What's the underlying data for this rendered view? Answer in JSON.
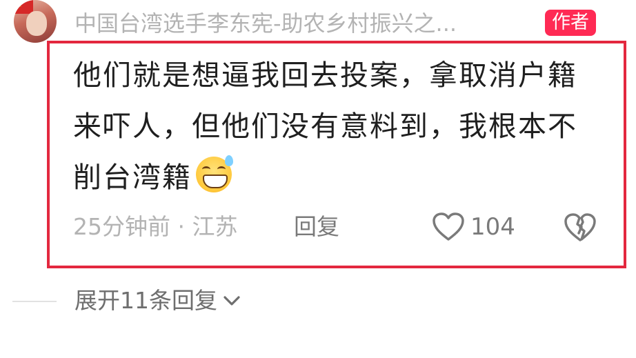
{
  "comment": {
    "author_name": "中国台湾选手李东宪-助农乡村振兴之...",
    "author_badge": "作者",
    "text_line1": "他们就是想逼我回去投案，拿取消户籍",
    "text_line2": "来吓人，但他们没有意料到，我根本不",
    "text_line3": "削台湾籍",
    "emoji_icon": "grinning-sweat-emoji-icon",
    "time_location": "25分钟前 · 江苏",
    "reply_label": "回复",
    "like_count": "104",
    "like_icon": "heart-outline-icon",
    "dislike_icon": "broken-heart-icon"
  },
  "replies": {
    "expand_label": "展开11条回复",
    "expand_icon": "chevron-down-icon"
  },
  "colors": {
    "badge": "#ff2a54",
    "highlight_frame": "#e3283f",
    "muted_text": "#b3b3b3",
    "body_text": "#1f1f1f"
  }
}
